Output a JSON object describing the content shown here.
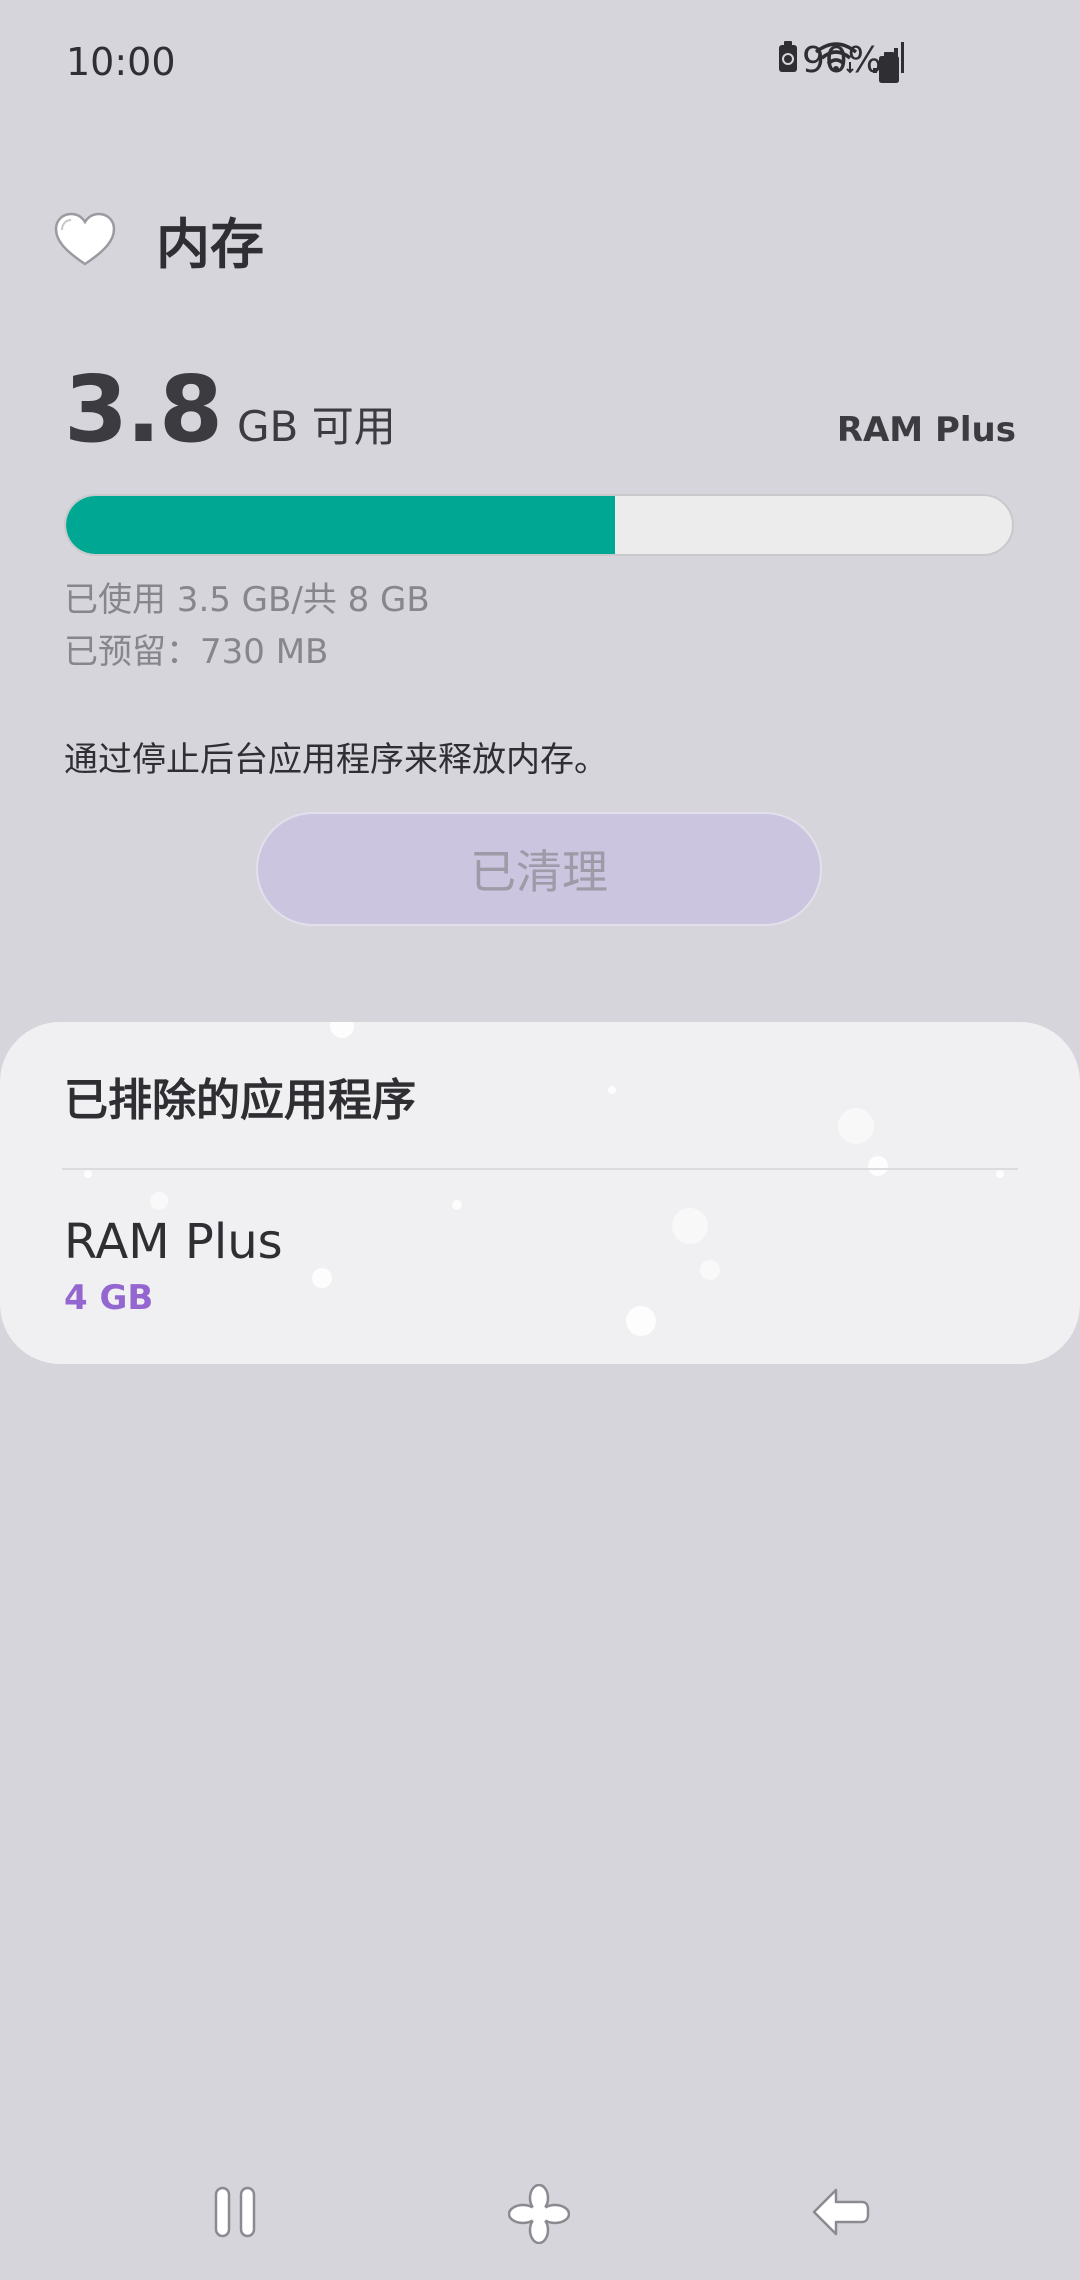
{
  "status_bar": {
    "time": "10:00",
    "battery_text": "90%",
    "icons": [
      "battery-saver-icon",
      "wifi-icon",
      "signal-icon",
      "battery-icon"
    ]
  },
  "header": {
    "title": "内存",
    "icon": "heart-icon"
  },
  "memory": {
    "available_number": "3.8",
    "available_unit": "GB 可用",
    "ram_plus_label": "RAM Plus",
    "used_fraction": 0.58,
    "used_line": "已使用 3.5 GB/共 8 GB",
    "reserved_line": "已预留：730 MB",
    "hint": "通过停止后台应用程序来释放内存。",
    "clean_button_label": "已清理"
  },
  "card": {
    "excluded_apps_label": "已排除的应用程序",
    "ram_plus_title": "RAM Plus",
    "ram_plus_value": "4 GB"
  },
  "nav_bar": {
    "buttons": [
      "recents-icon",
      "home-icon",
      "back-icon"
    ]
  },
  "colors": {
    "background": "#d6d5db",
    "progress_fill": "#00a893",
    "accent_purple": "#9466d0",
    "button_bg": "#cbc5df"
  }
}
